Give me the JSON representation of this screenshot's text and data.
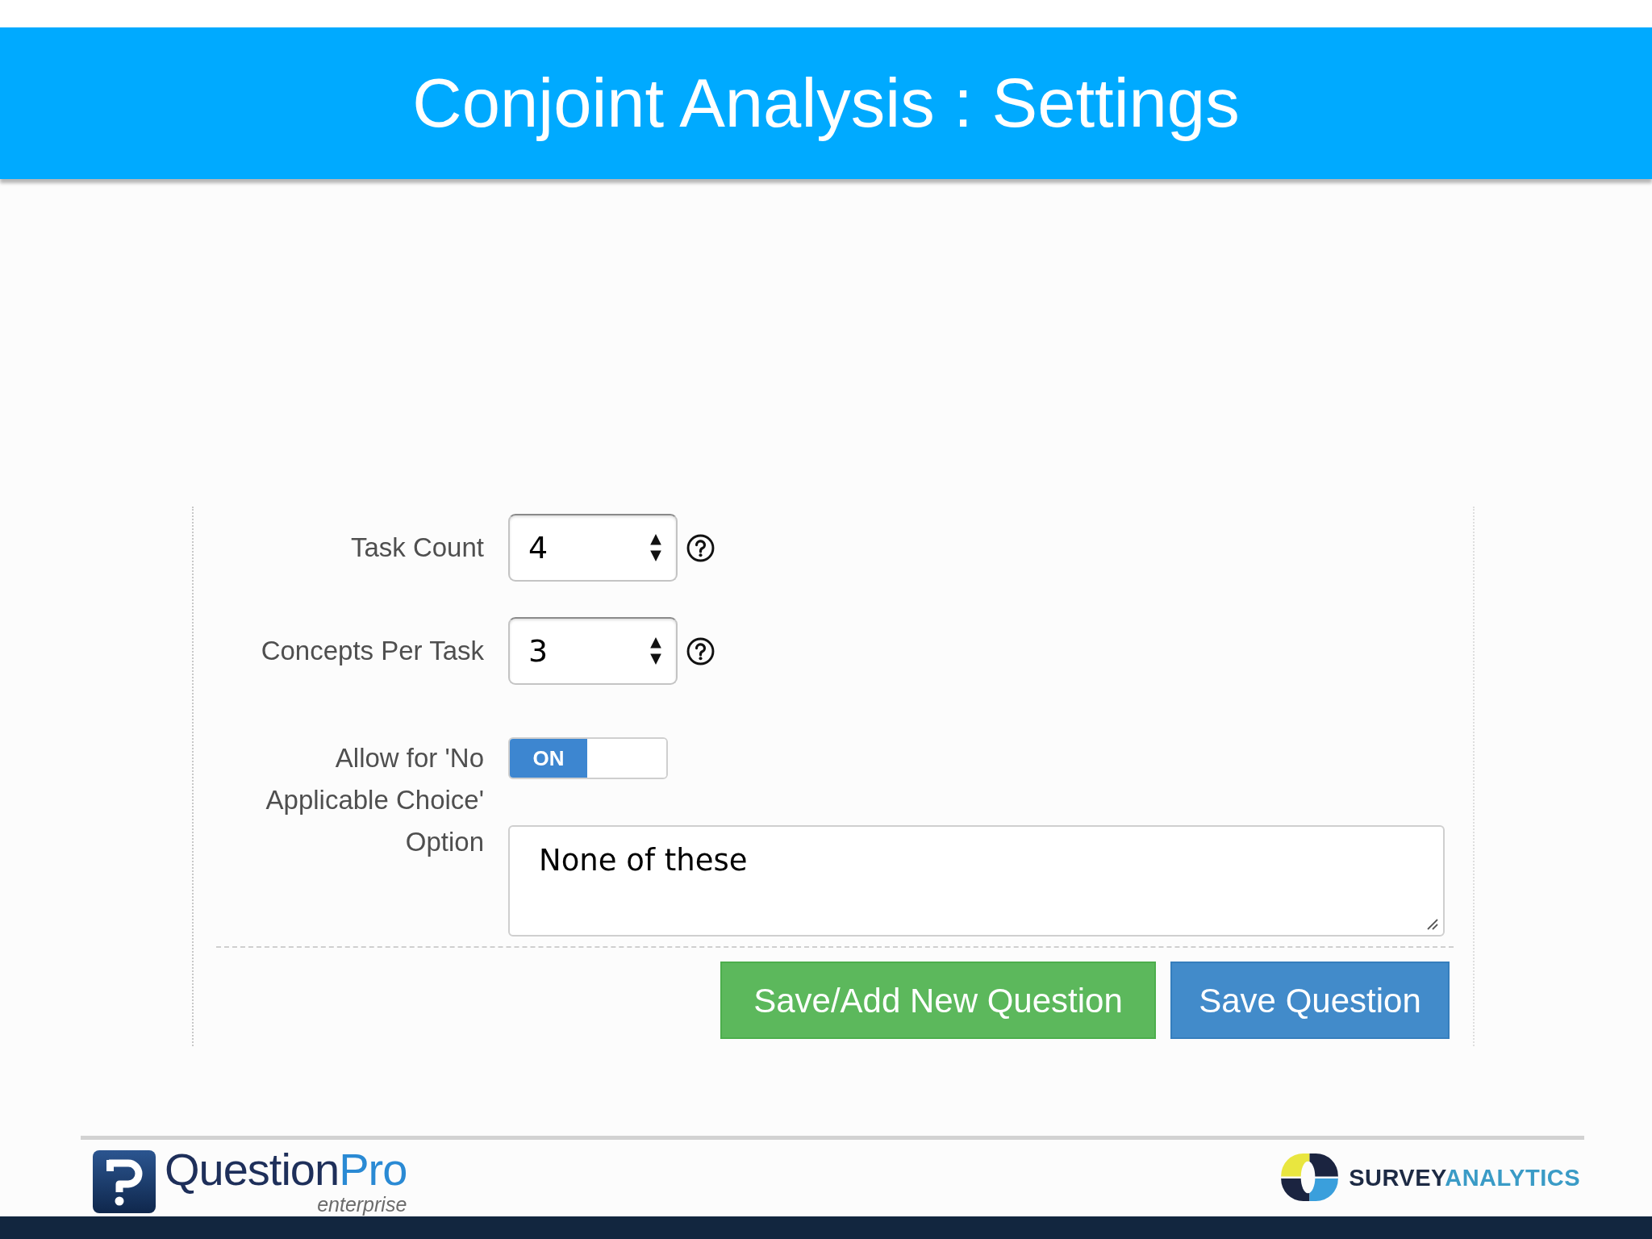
{
  "header": {
    "title": "Conjoint Analysis : Settings"
  },
  "form": {
    "fields": [
      {
        "kind": "select",
        "label": "Task Count",
        "value": "4",
        "help": true
      },
      {
        "kind": "select",
        "label": "Concepts Per Task",
        "value": "3",
        "help": true
      },
      {
        "kind": "toggle",
        "label": "Allow for 'No Applicable Choice' Option",
        "on": true,
        "on_text": "ON",
        "text": "None of these"
      }
    ],
    "buttons": [
      {
        "kind": "success",
        "label": "Save/Add New Question"
      },
      {
        "kind": "primary",
        "label": "Save Question"
      }
    ]
  },
  "footer": {
    "logos": [
      {
        "kind": "questionpro",
        "name": [
          "Question",
          "Pro"
        ],
        "tagline": "enterprise"
      },
      {
        "kind": "surveyanalytics",
        "name": [
          "SURVEY",
          "ANALYTICS"
        ]
      }
    ]
  }
}
